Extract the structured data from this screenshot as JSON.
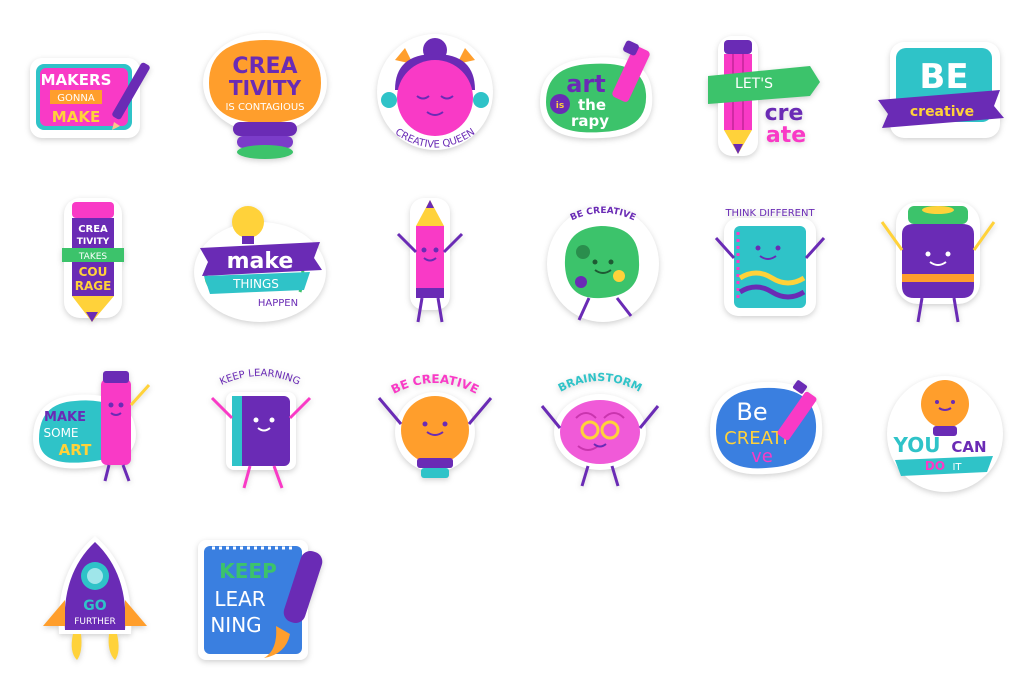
{
  "stickers": [
    {
      "id": "makers-gonna-make",
      "lines": [
        "MAKERS",
        "GONNA",
        "MAKE"
      ]
    },
    {
      "id": "creativity-contagious",
      "lines": [
        "CREA",
        "TIVITY",
        "IS CONTAGIOUS"
      ]
    },
    {
      "id": "creative-queen",
      "lines": [
        "CREATIVE QUEEN"
      ]
    },
    {
      "id": "art-is-therapy",
      "lines": [
        "art",
        "is",
        "the",
        "rapy"
      ]
    },
    {
      "id": "lets-create",
      "lines": [
        "LET'S",
        "cre",
        "ate"
      ]
    },
    {
      "id": "be-creative-banner",
      "lines": [
        "BE",
        "creative"
      ]
    },
    {
      "id": "creativity-takes-courage",
      "lines": [
        "CREA",
        "TIVITY",
        "TAKES",
        "COU",
        "RAGE"
      ]
    },
    {
      "id": "make-things-happen",
      "lines": [
        "make",
        "THINGS",
        "HAPPEN"
      ]
    },
    {
      "id": "pencil-character",
      "lines": []
    },
    {
      "id": "be-creative-palette",
      "lines": [
        "BE CREATIVE"
      ]
    },
    {
      "id": "think-different",
      "lines": [
        "THINK DIFFERENT"
      ]
    },
    {
      "id": "paint-jar-character",
      "lines": []
    },
    {
      "id": "make-some-art",
      "lines": [
        "MAKE",
        "SOME",
        "ART"
      ]
    },
    {
      "id": "keep-learning-book",
      "lines": [
        "KEEP LEARNING"
      ]
    },
    {
      "id": "be-creative-bulb",
      "lines": [
        "BE CREATIVE"
      ]
    },
    {
      "id": "brainstorm",
      "lines": [
        "BRAINSTORM"
      ]
    },
    {
      "id": "be-creative-blob",
      "lines": [
        "Be",
        "CREATI",
        "ve"
      ]
    },
    {
      "id": "you-can-do-it",
      "lines": [
        "YOU",
        "CAN",
        "DO",
        "IT"
      ]
    },
    {
      "id": "go-further",
      "lines": [
        "GO",
        "FURTHER"
      ]
    },
    {
      "id": "keep-learning-notebook",
      "lines": [
        "KEEP",
        "LEAR",
        "NING"
      ]
    }
  ],
  "colors": {
    "pink": "#f93ac6",
    "purple": "#6a2bb5",
    "teal": "#2fc3c8",
    "orange": "#ff9e2c",
    "yellow": "#ffd23a",
    "green": "#3cc36b",
    "blue": "#3a7fe0",
    "white": "#ffffff"
  }
}
